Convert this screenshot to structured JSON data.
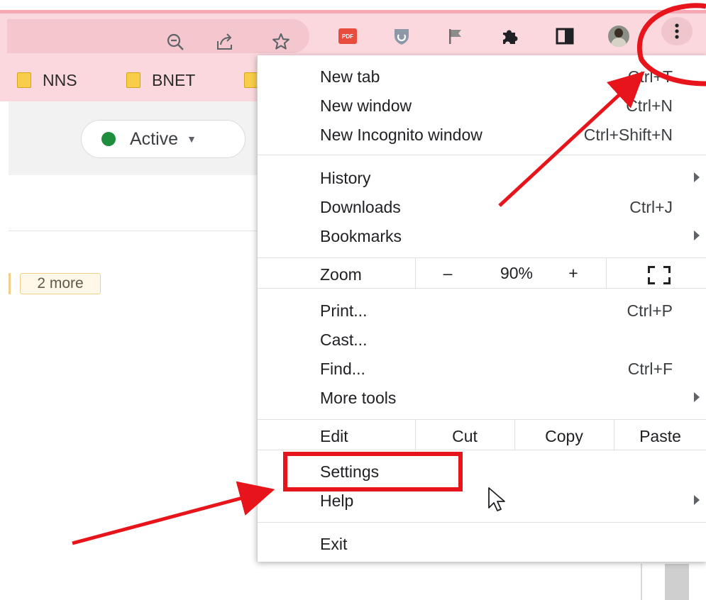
{
  "browser": {
    "icons": [
      "zoom-out-icon",
      "share-icon",
      "bookmark-star-icon",
      "pdf-extension-icon",
      "shield-extension-icon",
      "flag-extension-icon",
      "extensions-puzzle-icon",
      "side-panel-icon",
      "profile-avatar",
      "more-menu-icon"
    ],
    "pdf_icon_text": "PDF"
  },
  "bookmarks": [
    {
      "label": "NNS"
    },
    {
      "label": "BNET"
    }
  ],
  "page": {
    "status_label": "Active",
    "more_chip": "2 more"
  },
  "menu": {
    "new_tab": {
      "label": "New tab",
      "shortcut": "Ctrl+T"
    },
    "new_window": {
      "label": "New window",
      "shortcut": "Ctrl+N"
    },
    "incognito": {
      "label": "New Incognito window",
      "shortcut": "Ctrl+Shift+N"
    },
    "history": {
      "label": "History"
    },
    "downloads": {
      "label": "Downloads",
      "shortcut": "Ctrl+J"
    },
    "bookmarks": {
      "label": "Bookmarks"
    },
    "zoom": {
      "label": "Zoom",
      "minus": "–",
      "value": "90%",
      "plus": "+"
    },
    "print": {
      "label": "Print...",
      "shortcut": "Ctrl+P"
    },
    "cast": {
      "label": "Cast..."
    },
    "find": {
      "label": "Find...",
      "shortcut": "Ctrl+F"
    },
    "more_tools": {
      "label": "More tools"
    },
    "edit": {
      "label": "Edit",
      "cut": "Cut",
      "copy": "Copy",
      "paste": "Paste"
    },
    "settings": {
      "label": "Settings"
    },
    "help": {
      "label": "Help"
    },
    "exit": {
      "label": "Exit"
    }
  },
  "annotation": {
    "color": "#e8141c"
  }
}
